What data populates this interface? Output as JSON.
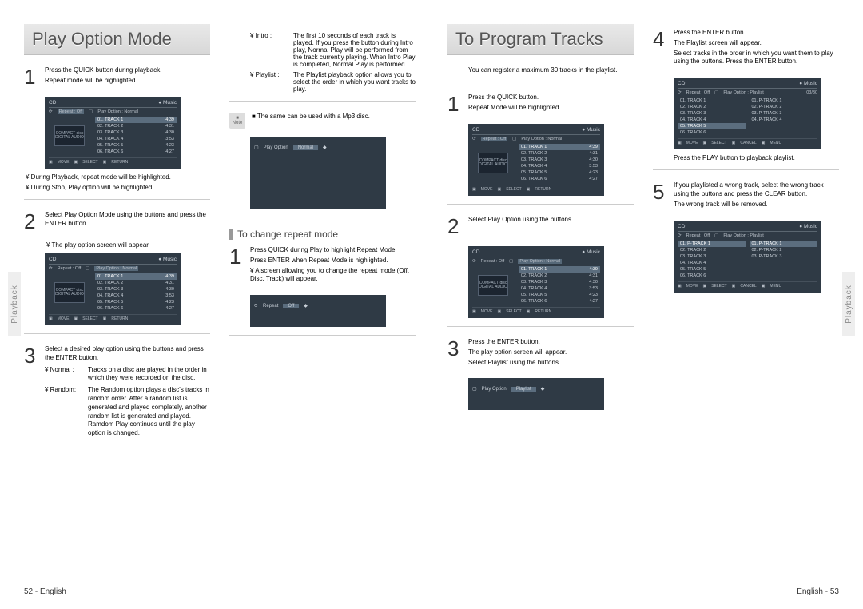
{
  "left_page": {
    "tab": "Playback",
    "title": "Play Option Mode",
    "footer": "52 - English",
    "col1": {
      "step1": {
        "num": "1",
        "l1": "Press the QUICK button during playback.",
        "l2": "Repeat mode will be highlighted.",
        "sub1": "¥ During Playback, repeat mode will be highlighted.",
        "sub2": "¥ During Stop, Play option will be highlighted."
      },
      "step2": {
        "num": "2",
        "l1": "Select Play Option Mode using the      buttons and press the ENTER button.",
        "sub1": "¥ The play option screen will appear."
      },
      "step3": {
        "num": "3",
        "l1": "Select a desired play option using the      buttons and press the ENTER button.",
        "normal_t": "¥ Normal :",
        "normal_d": "Tracks on a disc are played in the order in which they were recorded on the disc.",
        "random_t": "¥ Random:",
        "random_d": "The Random option plays a disc's tracks in random order. After a random list is generated and played completely, another random list is generated and played. Ramdom Play continues until the play option is changed."
      }
    },
    "col2": {
      "defs": {
        "intro_t": "¥ Intro   :",
        "intro_d": "The first 10 seconds of each track is played. If you press the   button during Intro play, Normal Play will be performed from the track currently playing. When Intro Play is completed, Normal Play is performed.",
        "playlist_t": "¥ Playlist :",
        "playlist_d": "The Playlist playback option allows you to select the order in which you want tracks to play."
      },
      "note": "■ The same can be used with a Mp3 disc.",
      "note_label": "Note",
      "sub_head": "To change repeat mode",
      "step1": {
        "num": "1",
        "l1": "Press QUICK during Play to highlight Repeat Mode.",
        "l2": "Press ENTER when Repeat Mode is highlighted.",
        "l3": "¥ A screen allowing you to change the repeat mode (Off, Disc, Track) will appear."
      }
    },
    "osd_common": {
      "hdr_l": "CD",
      "hdr_r": "● Music",
      "sub_repeat": "Repeat : Off",
      "sub_option": "Play Option : Normal",
      "disc": "COMPACT disc DIGITAL AUDIO",
      "rows": [
        [
          "01. TRACK 1",
          "4:39"
        ],
        [
          "02. TRACK 2",
          "4:31"
        ],
        [
          "03. TRACK 3",
          "4:30"
        ],
        [
          "04. TRACK 4",
          "3:53"
        ],
        [
          "05. TRACK 5",
          "4:23"
        ],
        [
          "06. TRACK 6",
          "4:27"
        ]
      ],
      "ft": [
        "MOVE",
        "SELECT",
        "RETURN"
      ]
    },
    "osd_playopt": {
      "label": "Play Option",
      "value": "Normal"
    },
    "osd_repeat": {
      "label": "Repeat",
      "value": "Off"
    }
  },
  "right_page": {
    "tab": "Playback",
    "title": "To Program Tracks",
    "footer": "English - 53",
    "col1": {
      "intro": "You can register a maximum 30 tracks in the playlist.",
      "step1": {
        "num": "1",
        "l1": "Press the QUICK button.",
        "l2": "Repeat Mode will be highlighted."
      },
      "step2": {
        "num": "2",
        "l1": "Select Play Option using the      buttons."
      },
      "step3": {
        "num": "3",
        "l1": "Press the ENTER button.",
        "l2": "The play option screen will appear.",
        "l3": "Select Playlist using the      buttons."
      }
    },
    "col2": {
      "step4": {
        "num": "4",
        "l1": "Press the ENTER button.",
        "l2": "The Playlist screen will appear.",
        "l3": "Select tracks in the order in which you want them to play using the      buttons. Press the ENTER button."
      },
      "after4": "Press the PLAY button to playback playlist.",
      "step5": {
        "num": "5",
        "l1": "If you playlisted a wrong track, select the wrong track using the      buttons and press the CLEAR button.",
        "l2": "The wrong track will be removed."
      }
    },
    "osd_playopt": {
      "label": "Play Option",
      "value": "Playlist"
    },
    "osd_playlist": {
      "hdr_l": "CD",
      "hdr_r": "● Music",
      "sub_repeat": "Repeat : Off",
      "sub_option": "Play Option : Playlist",
      "left_rows": [
        "01. TRACK 1",
        "02. TRACK 2",
        "03. TRACK 3",
        "04. TRACK 4",
        "05. TRACK 5",
        "06. TRACK 6"
      ],
      "right_rows_a": [
        "01. P-TRACK 1",
        "02. P-TRACK 2",
        "03. P-TRACK 3",
        "04. P-TRACK 4"
      ],
      "right_rows_b": [
        "01. P-TRACK 1",
        "02. P-TRACK 2",
        "03. P-TRACK 3"
      ],
      "num_badge": "03/30",
      "ft": [
        "MOVE",
        "SELECT",
        "CANCEL",
        "MENU"
      ]
    }
  }
}
